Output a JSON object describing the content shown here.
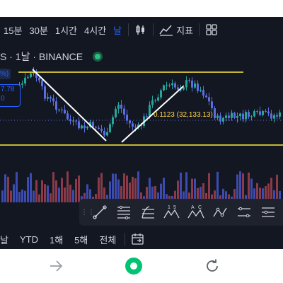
{
  "toolbar": {
    "timeframes": [
      "15분",
      "30분",
      "1시간",
      "4시간",
      "날"
    ],
    "active_timeframe": "날",
    "candle_icon": "candlestick-icon",
    "indicators_label": "지표",
    "layout_icon": "grid-icon"
  },
  "legend": {
    "symbol_line": "S · 1날 · BINANCE",
    "pct_badge": "%)",
    "price_top": "7.78",
    "price_bottom": "0"
  },
  "fib_labels": "0.1123 (32,133.13)",
  "drawing_tools": [
    "trend-line-icon",
    "parallel-channel-icon",
    "fib-retracement-icon",
    "pattern-xabcd-icon",
    "elliott-wave-icon",
    "abc-pattern-icon",
    "path-icon",
    "price-range-icon",
    "date-range-icon"
  ],
  "drawing_tool_labels": {
    "wave_1": "1",
    "wave_5": "5",
    "abc_a": "A",
    "abc_c": "C"
  },
  "range_bar": {
    "items": [
      "날",
      "YTD",
      "1해",
      "5해",
      "전체"
    ],
    "date_icon": "calendar-goto-icon"
  },
  "nav": {
    "forward_icon": "arrow-right-icon",
    "home_icon": "home-circle-icon",
    "reload_icon": "reload-icon"
  },
  "colors": {
    "up": "#26a69a",
    "down": "#5b6de0",
    "volume_up": "#8a3a48",
    "volume_down": "#3b4bb0",
    "horizontal_line": "#ffeb3b",
    "trend_line": "#ffffff",
    "accent": "#2962ff",
    "nav_green": "#00c471"
  }
}
